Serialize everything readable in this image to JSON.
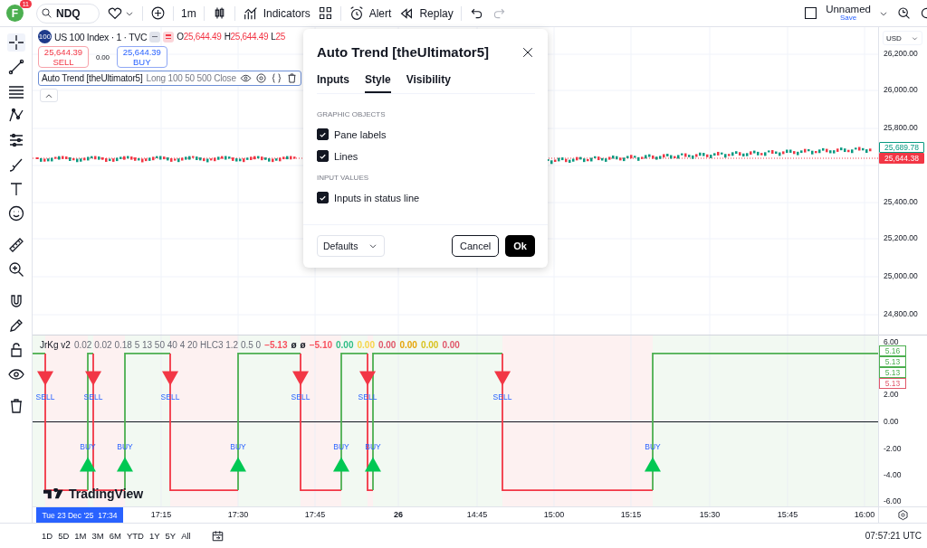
{
  "top_bar": {
    "avatar": {
      "letter": "F",
      "badge": "11"
    },
    "symbol_search": {
      "value": "NDQ"
    },
    "interval": "1m",
    "indicators_button": "Indicators",
    "alert_button": "Alert",
    "replay_button": "Replay",
    "layout": {
      "name": "Unnamed",
      "save": "Save"
    }
  },
  "legend": {
    "logo": "100",
    "symbol": "US 100 Index · 1 · TVC",
    "ohlc": [
      {
        "key": "O",
        "value": "25,644.49"
      },
      {
        "key": "H",
        "value": "25,644.49"
      },
      {
        "key": "L",
        "value": "25"
      }
    ],
    "sell": {
      "price": "25,644.39",
      "label": "SELL"
    },
    "spread": "0.00",
    "buy": {
      "price": "25,644.39",
      "label": "BUY"
    },
    "study": {
      "name": "Auto Trend [theUltimator5]",
      "params": "Long 100 50 500 Close"
    }
  },
  "dialog": {
    "title": "Auto Trend [theUltimator5]",
    "tabs": [
      {
        "label": "Inputs",
        "selected": false
      },
      {
        "label": "Style",
        "selected": true
      },
      {
        "label": "Visibility",
        "selected": false
      }
    ],
    "sections": [
      {
        "heading": "GRAPHIC OBJECTS",
        "options": [
          {
            "label": "Pane labels",
            "checked": true
          },
          {
            "label": "Lines",
            "checked": true
          }
        ]
      },
      {
        "heading": "INPUT VALUES",
        "options": [
          {
            "label": "Inputs in status line",
            "checked": true
          }
        ]
      }
    ],
    "defaults": "Defaults",
    "cancel": "Cancel",
    "ok": "Ok"
  },
  "price_axis": {
    "currency": "USD",
    "ticks": [
      "26,200.00",
      "26,000.00",
      "25,800.00",
      "25,400.00",
      "25,200.00",
      "25,000.00",
      "24,800.00"
    ],
    "last_prices": [
      {
        "text": "25,689.78",
        "kind": "outline",
        "color": "#089981"
      },
      {
        "text": "25,644.38",
        "kind": "filled",
        "color": "#f23645"
      }
    ]
  },
  "indicator": {
    "name": "JrKg v2",
    "params": "0.02 0.02 0.18 5 13 50 40 4 20 HLC3 1.2 0.5 0",
    "values": [
      {
        "text": "−5.13",
        "color": "#f7525f"
      },
      {
        "text": "ø",
        "color": "#131722"
      },
      {
        "text": "ø",
        "color": "#131722"
      },
      {
        "text": "−5.10",
        "color": "#f7525f"
      },
      {
        "text": "0.00",
        "color": "#2ebd85"
      },
      {
        "text": "0.00",
        "color": "#f5d547"
      },
      {
        "text": "0.00",
        "color": "#e0576a"
      },
      {
        "text": "0.00",
        "color": "#e5a50a"
      },
      {
        "text": "0.00",
        "color": "#d9c21f"
      },
      {
        "text": "0.00",
        "color": "#e0576a"
      }
    ],
    "signals": [
      {
        "kind": "sell",
        "label": "SELL"
      },
      {
        "kind": "sell",
        "label": "SELL"
      },
      {
        "kind": "sell",
        "label": "SELL"
      },
      {
        "kind": "sell",
        "label": "SELL"
      },
      {
        "kind": "sell",
        "label": "SELL"
      },
      {
        "kind": "sell",
        "label": "SELL"
      },
      {
        "kind": "buy",
        "label": "BUY"
      },
      {
        "kind": "buy",
        "label": "BUY"
      },
      {
        "kind": "buy",
        "label": "BUY"
      },
      {
        "kind": "buy",
        "label": "BUY"
      },
      {
        "kind": "buy",
        "label": "BUY"
      },
      {
        "kind": "buy",
        "label": "BUY"
      }
    ],
    "axis_ticks": [
      "6.00",
      "2.00",
      "0.00",
      "-2.00",
      "-4.00",
      "-6.00"
    ],
    "value_labels": [
      {
        "text": "5.16",
        "color": "#4caf50"
      },
      {
        "text": "5.13",
        "color": "#4caf50"
      },
      {
        "text": "5.13",
        "color": "#4caf50"
      },
      {
        "text": "5.13",
        "color": "#e0576a"
      }
    ],
    "chart_logo": "TradingView"
  },
  "time_axis": {
    "cursor_date": "Tue 23 Dec '25",
    "cursor_time": "17:34",
    "ticks": [
      {
        "text": "17:15",
        "bold": false
      },
      {
        "text": "17:30",
        "bold": false
      },
      {
        "text": "17:45",
        "bold": false
      },
      {
        "text": "26",
        "bold": true
      },
      {
        "text": "14:45",
        "bold": false
      },
      {
        "text": "15:00",
        "bold": false
      },
      {
        "text": "15:15",
        "bold": false
      },
      {
        "text": "15:30",
        "bold": false
      },
      {
        "text": "15:45",
        "bold": false
      },
      {
        "text": "16:00",
        "bold": false
      }
    ]
  },
  "bottom_bar": {
    "ranges": [
      "1D",
      "5D",
      "1M",
      "3M",
      "6M",
      "YTD",
      "1Y",
      "5Y",
      "All"
    ],
    "clock": "07:57:21 UTC"
  }
}
